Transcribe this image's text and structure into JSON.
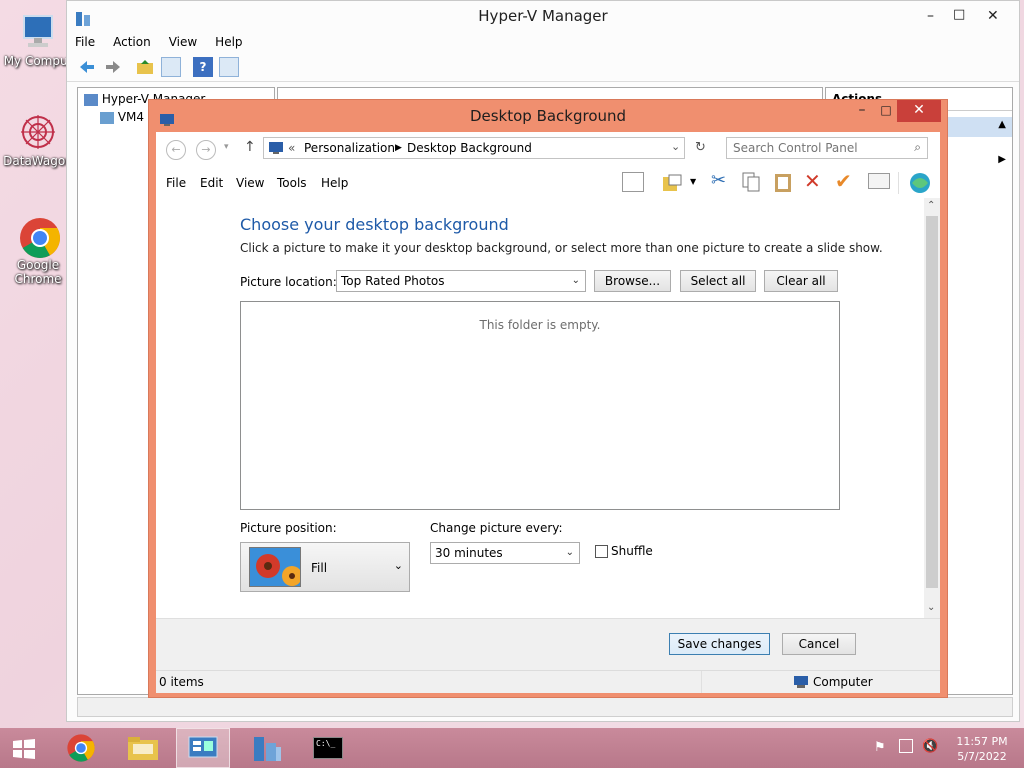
{
  "desktop": {
    "icons": [
      {
        "label": "My Comput"
      },
      {
        "label": "DataWagon"
      },
      {
        "label": "Google Chrome",
        "line1": "Google",
        "line2": "Chrome"
      }
    ]
  },
  "hyperv": {
    "title": "Hyper-V Manager",
    "menu": [
      "File",
      "Action",
      "View",
      "Help"
    ],
    "tree_root": "Hyper-V Manager",
    "tree_child": "VM4",
    "actions_header": "Actions"
  },
  "dialog": {
    "title": "Desktop Background",
    "breadcrumb_prefix": "«",
    "breadcrumb": [
      "Personalization",
      "Desktop Background"
    ],
    "search_placeholder": "Search Control Panel",
    "menu": [
      "File",
      "Edit",
      "View",
      "Tools",
      "Help"
    ],
    "heading": "Choose your desktop background",
    "description": "Click a picture to make it your desktop background, or select more than one picture to create a slide show.",
    "picture_location_label": "Picture location:",
    "picture_location_value": "Top Rated Photos",
    "browse_label": "Browse...",
    "select_all_label": "Select all",
    "clear_all_label": "Clear all",
    "empty_message": "This folder is empty.",
    "picture_position_label": "Picture position:",
    "picture_position_value": "Fill",
    "change_every_label": "Change picture every:",
    "change_every_value": "30 minutes",
    "shuffle_label": "Shuffle",
    "shuffle_checked": false,
    "save_label": "Save changes",
    "cancel_label": "Cancel",
    "status_items": "0 items",
    "status_location": "Computer"
  },
  "taskbar": {
    "time": "11:57 PM",
    "date": "5/7/2022"
  },
  "colors": {
    "dialog_frame": "#f08f6f",
    "heading": "#1e5aa8",
    "taskbar": "#c48596"
  }
}
